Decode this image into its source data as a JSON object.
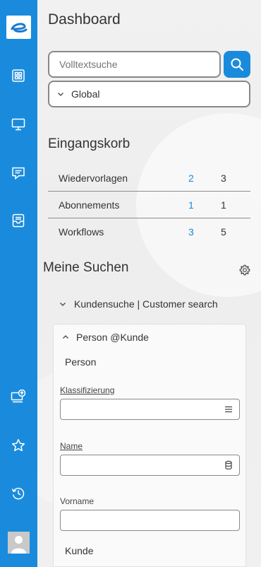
{
  "app": {
    "title": "Dashboard"
  },
  "search": {
    "placeholder": "Volltextsuche",
    "scope": "Global"
  },
  "inbox": {
    "title": "Eingangskorb",
    "rows": [
      {
        "label": "Wiedervorlagen",
        "new": "2",
        "total": "3"
      },
      {
        "label": "Abonnements",
        "new": "1",
        "total": "1"
      },
      {
        "label": "Workflows",
        "new": "3",
        "total": "5"
      }
    ]
  },
  "my_searches": {
    "title": "Meine Suchen",
    "group": "Kundensuche | Customer search",
    "panel": {
      "title": "Person @Kunde",
      "subtitle": "Person",
      "fields": [
        {
          "label": "Klassifizierung",
          "icon": "list-icon"
        },
        {
          "label": "Name",
          "icon": "database-icon"
        },
        {
          "label": "Vorname",
          "icon": ""
        }
      ],
      "next_section": "Kunde"
    }
  },
  "sidebar": {
    "icons": [
      "dashboard-icon",
      "monitor-icon",
      "message-icon",
      "inbox-icon",
      "upload-icon",
      "star-icon",
      "history-icon",
      "avatar"
    ]
  },
  "colors": {
    "accent": "#1a8bdc",
    "sidebar": "#1a8bdc",
    "background": "#ececec"
  }
}
